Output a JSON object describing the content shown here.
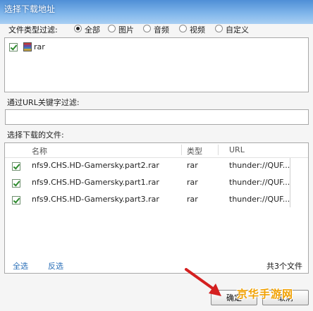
{
  "window": {
    "title": "选择下载地址"
  },
  "type_filter": {
    "label": "文件类型过滤:",
    "options": [
      {
        "label": "全部",
        "checked": true
      },
      {
        "label": "图片",
        "checked": false
      },
      {
        "label": "音频",
        "checked": false
      },
      {
        "label": "视频",
        "checked": false
      },
      {
        "label": "自定义",
        "checked": false
      }
    ],
    "types": [
      {
        "label": "rar",
        "checked": true,
        "icon": "rar-archive-icon"
      }
    ]
  },
  "url_filter": {
    "label": "通过URL关键字过滤:",
    "value": ""
  },
  "files": {
    "label": "选择下载的文件:",
    "columns": {
      "name": "名称",
      "type": "类型",
      "url": "URL"
    },
    "rows": [
      {
        "name": "nfs9.CHS.HD-Gamersky.part2.rar",
        "type": "rar",
        "url": "thunder://QUF...",
        "checked": true
      },
      {
        "name": "nfs9.CHS.HD-Gamersky.part1.rar",
        "type": "rar",
        "url": "thunder://QUF...",
        "checked": true
      },
      {
        "name": "nfs9.CHS.HD-Gamersky.part3.rar",
        "type": "rar",
        "url": "thunder://QUF...",
        "checked": true
      }
    ],
    "select_all": "全选",
    "invert": "反选",
    "count_text": "共3个文件"
  },
  "buttons": {
    "ok": "确定",
    "cancel": "取消"
  },
  "watermark": {
    "text": "京华手游网"
  },
  "colors": {
    "title_bar": "#5b9be0",
    "link": "#2a6fb8",
    "arrow": "#d42020",
    "check": "#2e8b2e"
  }
}
